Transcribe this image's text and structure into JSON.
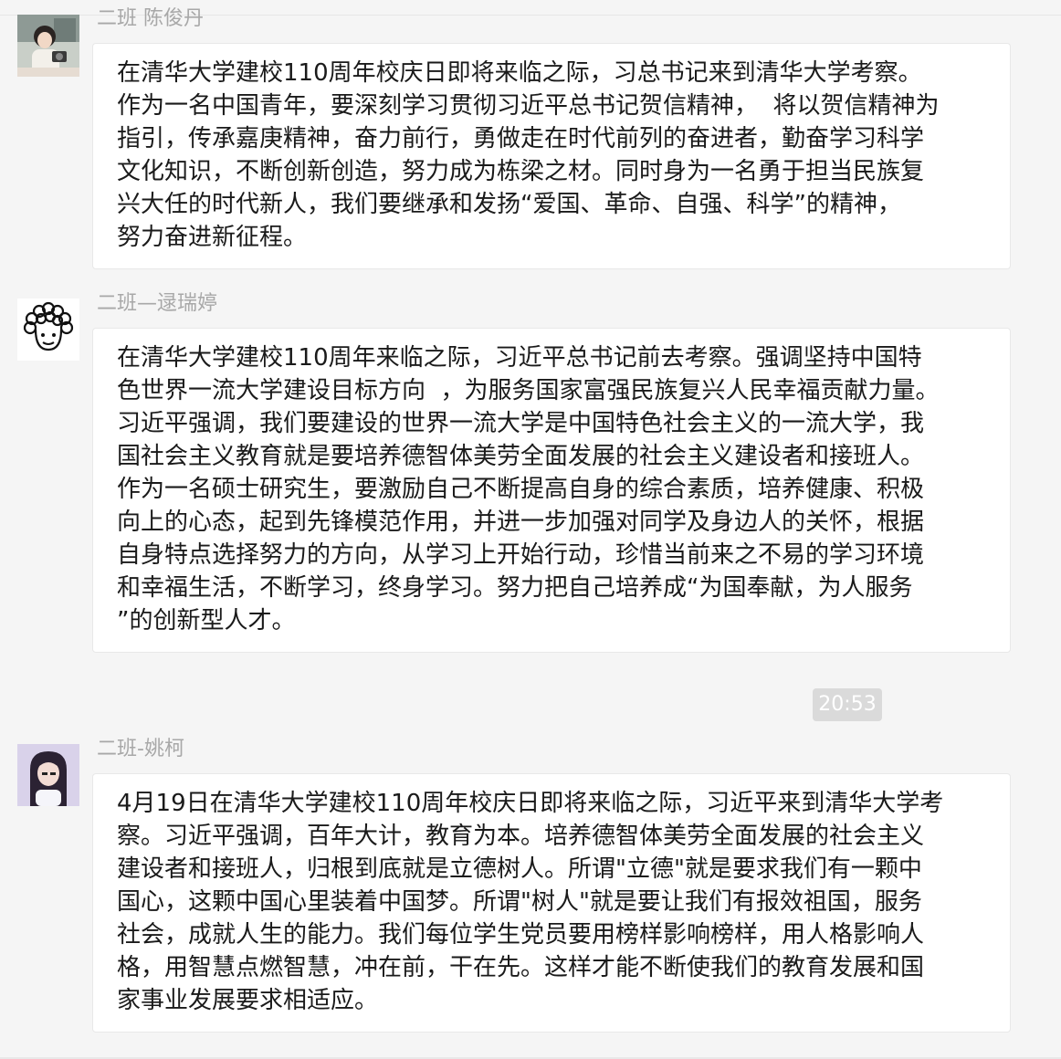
{
  "messages": [
    {
      "sender": "二班 陈俊丹",
      "text": "在清华大学建校110周年校庆日即将来临之际，习总书记来到清华大学考察。\n作为一名中国青年，要深刻学习贯彻习近平总书记贺信精神，  将以贺信精神为\n指引，传承嘉庚精神，奋力前行，勇做走在时代前列的奋进者，勤奋学习科学\n文化知识，不断创新创造，努力成为栋梁之材。同时身为一名勇于担当民族复\n兴大任的时代新人，我们要继承和发扬“爱国、革命、自强、科学”的精神，\n努力奋进新征程。"
    },
    {
      "sender": "二班—逯瑞婷",
      "text": "在清华大学建校110周年来临之际，习近平总书记前去考察。强调坚持中国特\n色世界一流大学建设目标方向  ，为服务国家富强民族复兴人民幸福贡献力量。\n习近平强调，我们要建设的世界一流大学是中国特色社会主义的一流大学，我\n国社会主义教育就是要培养德智体美劳全面发展的社会主义建设者和接班人。\n作为一名硕士研究生，要激励自己不断提高自身的综合素质，培养健康、积极\n向上的心态，起到先锋模范作用，并进一步加强对同学及身边人的关怀，根据\n自身特点选择努力的方向，从学习上开始行动，珍惜当前来之不易的学习环境\n和幸福生活，不断学习，终身学习。努力把自己培养成“为国奉献，为人服务\n”的创新型人才。"
    },
    {
      "sender": "二班-姚柯",
      "text": "4月19日在清华大学建校110周年校庆日即将来临之际，习近平来到清华大学考\n察。习近平强调，百年大计，教育为本。培养德智体美劳全面发展的社会主义\n建设者和接班人，归根到底就是立德树人。所谓\"立德\"就是要求我们有一颗中\n国心，这颗中国心里装着中国梦。所谓\"树人\"就是要让我们有报效祖国，服务\n社会，成就人生的能力。我们每位学生党员要用榜样影响榜样，用人格影响人\n格，用智慧点燃智慧，冲在前，干在先。这样才能不断使我们的教育发展和国\n家事业发展要求相适应。"
    }
  ],
  "timestamp": "20:53",
  "avatars": [
    "girl-with-camera-avatar",
    "curly-hair-cartoon-avatar",
    "girl-with-long-hair-avatar"
  ]
}
